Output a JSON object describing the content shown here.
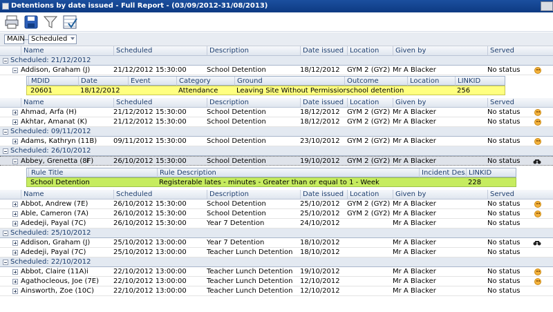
{
  "window": {
    "title": "Detentions by date issued - Full Report - (03/09/2012-31/08/2013)"
  },
  "grouping": {
    "main_label": "MAIN",
    "group_field": "Scheduled"
  },
  "columns": [
    "Name",
    "Scheduled",
    "Description",
    "Date issued",
    "Location",
    "Given by",
    "Served"
  ],
  "groups": [
    {
      "header": "Scheduled: 21/12/2012",
      "rows": [
        {
          "name": "Addison, Graham (J)",
          "scheduled": "21/12/2012 15:30:00",
          "description": "School Detention",
          "date_issued": "18/12/2012",
          "location": "GYM 2 (GY2)",
          "given_by": "Mr A Blacker",
          "served": "No status",
          "status_icon": "smiley-icon",
          "expanded": true
        }
      ],
      "detail": {
        "columns": [
          "MDID",
          "Date",
          "Event",
          "Category",
          "Ground",
          "Outcome",
          "Location",
          "LINKID"
        ],
        "values": [
          "20601",
          "18/12/2012",
          "",
          "Attendance",
          "Leaving Site Without Permission",
          "school detention",
          "",
          "256"
        ]
      },
      "rows2": [
        {
          "name": "Ahmad, Arfa (H)",
          "scheduled": "21/12/2012 15:30:00",
          "description": "School Detention",
          "date_issued": "18/12/2012",
          "location": "GYM 2 (GY2)",
          "given_by": "Mr A Blacker",
          "served": "No status",
          "status_icon": "smiley-icon"
        },
        {
          "name": "Akhtar, Amanat (K)",
          "scheduled": "21/12/2012 15:30:00",
          "description": "School Detention",
          "date_issued": "18/12/2012",
          "location": "GYM 2 (GY2)",
          "given_by": "Mr A Blacker",
          "served": "No status",
          "status_icon": "smiley-icon"
        }
      ]
    },
    {
      "header": "Scheduled: 09/11/2012",
      "rows": [
        {
          "name": "Adams, Kathryn (11B)",
          "scheduled": "09/11/2012 15:30:00",
          "description": "School Detention",
          "date_issued": "23/10/2012",
          "location": "GYM 2 (GY2)",
          "given_by": "Mr A Blacker",
          "served": "No status",
          "status_icon": "smiley-icon"
        }
      ]
    },
    {
      "header": "Scheduled: 26/10/2012",
      "rows": [
        {
          "name": "Abbey, Grenetta (8F)",
          "flag": "i",
          "scheduled": "26/10/2012 15:30:00",
          "description": "School Detention",
          "date_issued": "19/10/2012",
          "location": "GYM 2 (GY2)",
          "given_by": "Mr A Blacker",
          "served": "No status",
          "status_icon": "binoculars-icon",
          "expanded": true
        }
      ],
      "detail": {
        "columns": [
          "Rule Title",
          "Rule Description",
          "Incident Des...",
          "LINKID"
        ],
        "values": [
          "School Detention",
          "Registerable lates - minutes - Greater than or equal to 1 - Week",
          "",
          "228"
        ]
      },
      "rows2": [
        {
          "name": "Abbot, Andrew (7E)",
          "scheduled": "26/10/2012 15:30:00",
          "description": "School Detention",
          "date_issued": "25/10/2012",
          "location": "GYM 2 (GY2)",
          "given_by": "Mr A Blacker",
          "served": "No status",
          "status_icon": "smiley-icon"
        },
        {
          "name": "Able, Cameron (7A)",
          "scheduled": "26/10/2012 15:30:00",
          "description": "School Detention",
          "date_issued": "25/10/2012",
          "location": "GYM 2 (GY2)",
          "given_by": "Mr A Blacker",
          "served": "No status",
          "status_icon": "smiley-icon"
        },
        {
          "name": "Adedeji, Payal (7C)",
          "scheduled": "26/10/2012 15:30:00",
          "description": "Year 7 Detention",
          "date_issued": "24/10/2012",
          "location": "",
          "given_by": "Mr A Blacker",
          "served": "No status",
          "status_icon": ""
        }
      ]
    },
    {
      "header": "Scheduled: 25/10/2012",
      "rows": [
        {
          "name": "Addison, Graham (J)",
          "scheduled": "25/10/2012 13:00:00",
          "description": "Year 7 Detention",
          "date_issued": "18/10/2012",
          "location": "",
          "given_by": "Mr A Blacker",
          "served": "No status",
          "status_icon": "binoculars-icon"
        },
        {
          "name": "Adedeji, Payal (7C)",
          "scheduled": "25/10/2012 13:00:00",
          "description": "Teacher Lunch Detention",
          "date_issued": "18/10/2012",
          "location": "",
          "given_by": "Mr A Blacker",
          "served": "No status",
          "status_icon": ""
        }
      ]
    },
    {
      "header": "Scheduled: 22/10/2012",
      "rows": [
        {
          "name": "Abbot, Claire (11A)",
          "flag": "i",
          "scheduled": "22/10/2012 13:00:00",
          "description": "Teacher Lunch Detention",
          "date_issued": "19/10/2012",
          "location": "",
          "given_by": "Mr A Blacker",
          "served": "No status",
          "status_icon": "smiley-icon"
        },
        {
          "name": "Agathocleous, Joe (7E)",
          "scheduled": "22/10/2012 13:00:00",
          "description": "Teacher Lunch Detention",
          "date_issued": "12/10/2012",
          "location": "",
          "given_by": "Mr A Blacker",
          "served": "No status",
          "status_icon": "smiley-icon"
        },
        {
          "name": "Ainsworth, Zoe (10C)",
          "scheduled": "22/10/2012 13:00:00",
          "description": "Teacher Lunch Detention",
          "date_issued": "12/10/2012",
          "location": "",
          "given_by": "Mr A Blacker",
          "served": "No status",
          "status_icon": ""
        }
      ]
    }
  ]
}
